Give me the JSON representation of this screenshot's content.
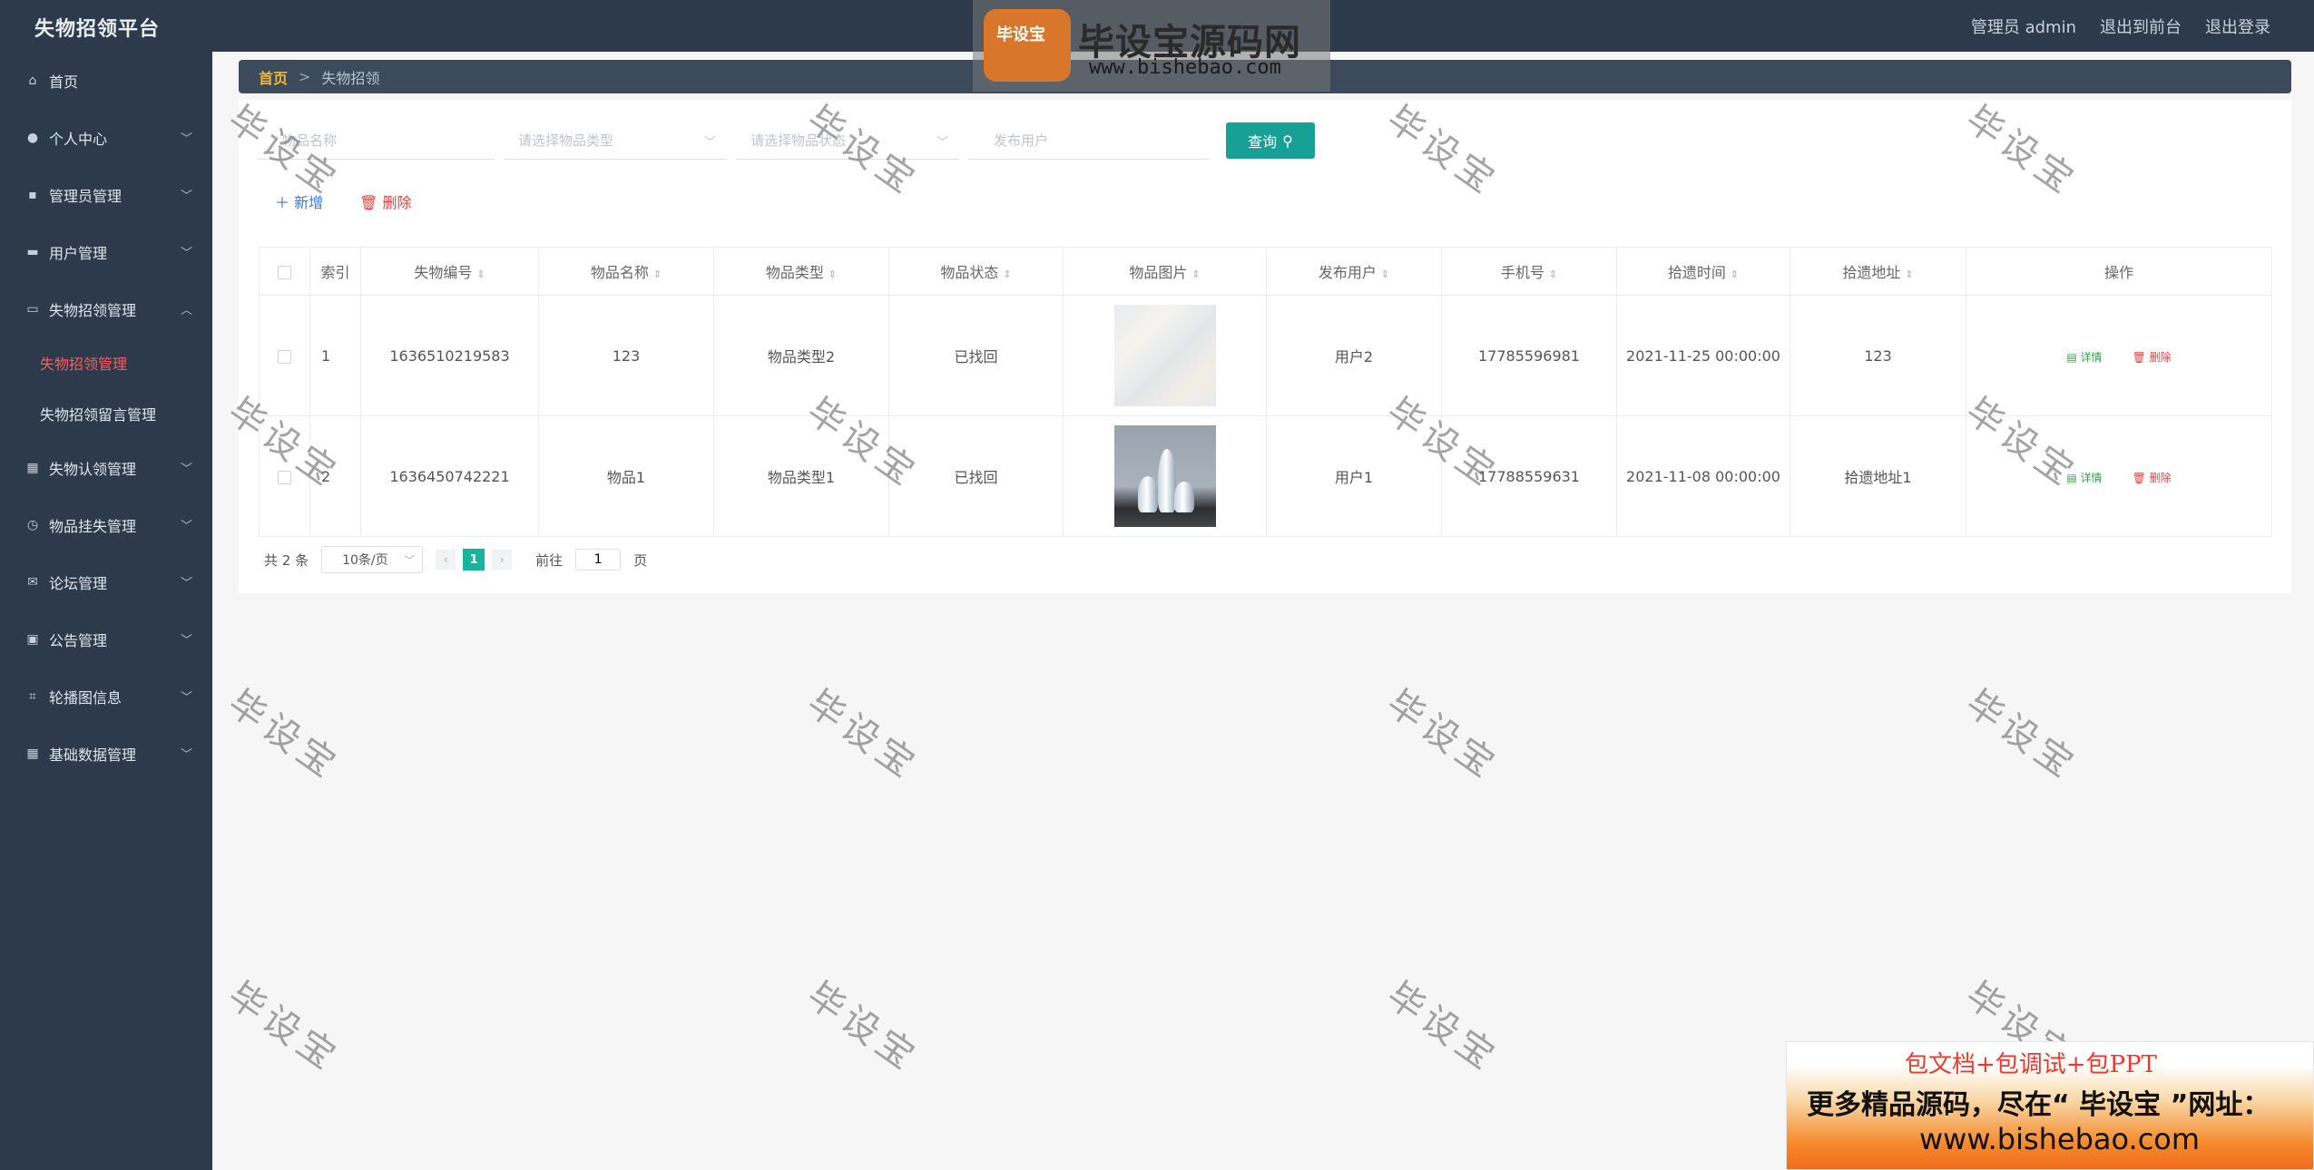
{
  "app": {
    "title": "失物招领平台"
  },
  "topbar": {
    "admin": "管理员 admin",
    "front": "退出到前台",
    "logout": "退出登录"
  },
  "sidebar": {
    "items": [
      {
        "label": "首页",
        "icon": "home-icon"
      },
      {
        "label": "个人中心",
        "icon": "user-icon"
      },
      {
        "label": "管理员管理",
        "icon": "chat-icon"
      },
      {
        "label": "用户管理",
        "icon": "briefcase-icon"
      },
      {
        "label": "失物招领管理",
        "icon": "card-icon"
      },
      {
        "label": "失物认领管理",
        "icon": "grid-icon"
      },
      {
        "label": "物品挂失管理",
        "icon": "clock-icon"
      },
      {
        "label": "论坛管理",
        "icon": "mail-icon"
      },
      {
        "label": "公告管理",
        "icon": "clipboard-icon"
      },
      {
        "label": "轮播图信息",
        "icon": "crop-icon"
      },
      {
        "label": "基础数据管理",
        "icon": "apps-icon"
      }
    ],
    "submenu": [
      {
        "label": "失物招领管理"
      },
      {
        "label": "失物招领留言管理"
      }
    ]
  },
  "breadcrumb": {
    "home": "首页",
    "sep": ">",
    "current": "失物招领"
  },
  "search": {
    "name_placeholder": "物品名称",
    "type_placeholder": "请选择物品类型",
    "status_placeholder": "请选择物品状态",
    "user_placeholder": "发布用户",
    "query_label": "查询"
  },
  "actions": {
    "add": "新增",
    "delete": "删除"
  },
  "table": {
    "headers": [
      "索引",
      "失物编号",
      "物品名称",
      "物品类型",
      "物品状态",
      "物品图片",
      "发布用户",
      "手机号",
      "拾遗时间",
      "拾遗地址",
      "操作"
    ],
    "rows": [
      {
        "index": "1",
        "code": "1636510219583",
        "name": "123",
        "type": "物品类型2",
        "status": "已找回",
        "user": "用户2",
        "phone": "17785596981",
        "time": "2021-11-25 00:00:00",
        "address": "123",
        "detail": "详情",
        "del": "删除"
      },
      {
        "index": "2",
        "code": "1636450742221",
        "name": "物品1",
        "type": "物品类型1",
        "status": "已找回",
        "user": "用户1",
        "phone": "17788559631",
        "time": "2021-11-08 00:00:00",
        "address": "拾遗地址1",
        "detail": "详情",
        "del": "删除"
      }
    ]
  },
  "pager": {
    "total": "共 2 条",
    "page_size": "10条/页",
    "current": "1",
    "goto": "前往",
    "goto_value": "1",
    "page_unit": "页"
  },
  "watermark": {
    "banner_title": "毕设宝源码网",
    "banner_url": "www.bishebao.com",
    "logo_text": "毕设宝",
    "mark": "毕设宝"
  },
  "ad": {
    "line1": "包文档+包调试+包PPT",
    "line2": "更多精品源码，尽在“ 毕设宝 ”网址：",
    "line3": "www.bishebao.com"
  }
}
